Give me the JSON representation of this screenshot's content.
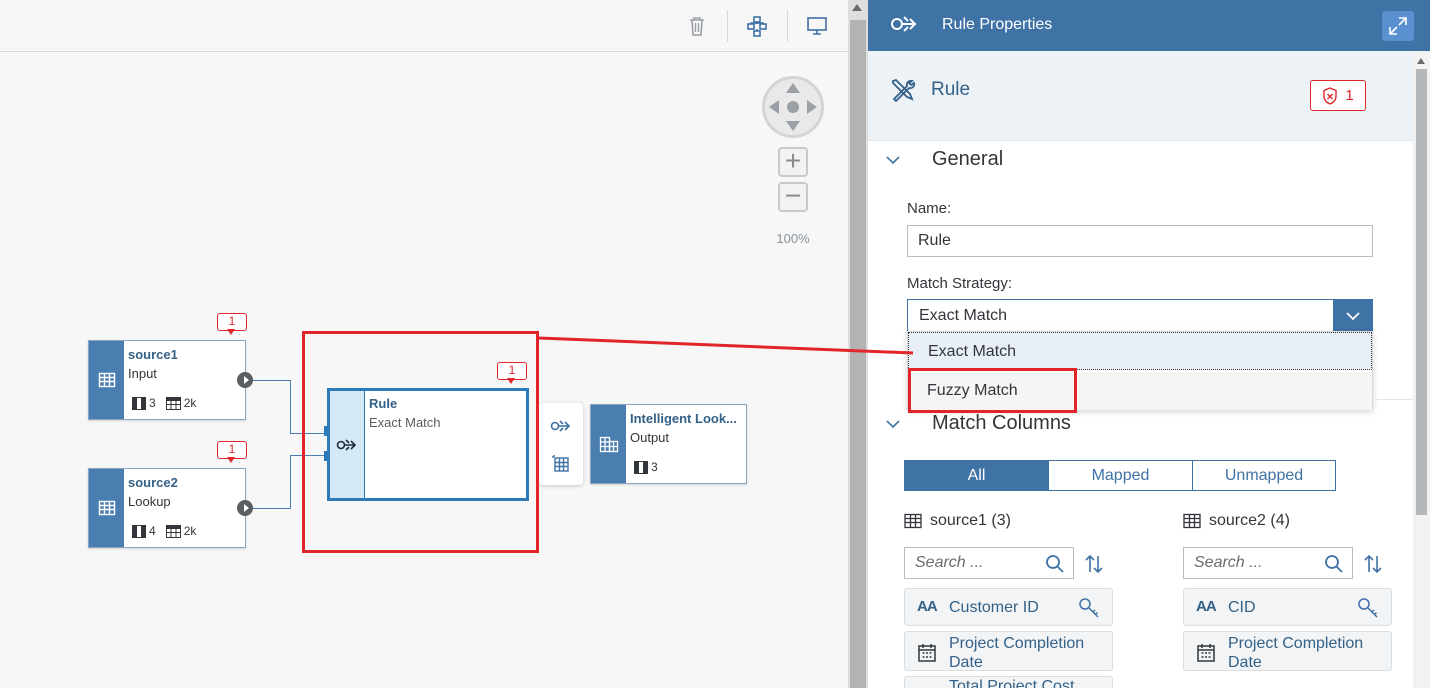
{
  "canvas": {
    "toolbar": {
      "delete_icon": "trash-icon",
      "layout_icon": "auto-layout-icon",
      "preview_icon": "monitor-icon"
    },
    "zoom": {
      "plus": "+",
      "minus": "−",
      "level": "100%"
    },
    "nodes": {
      "source1": {
        "title": "source1",
        "subtitle": "Input",
        "columns": "3",
        "rows": "2k",
        "badge": "1"
      },
      "source2": {
        "title": "source2",
        "subtitle": "Lookup",
        "columns": "4",
        "rows": "2k",
        "badge": "1"
      },
      "rule": {
        "title": "Rule",
        "subtitle": "Exact Match",
        "badge": "1"
      },
      "output": {
        "title": "Intelligent Look...",
        "subtitle": "Output",
        "columns": "3"
      }
    }
  },
  "panel": {
    "header_title": "Rule Properties",
    "rule_title": "Rule",
    "error_count": "1",
    "general": {
      "section_label": "General",
      "name_label": "Name:",
      "name_value": "Rule",
      "strategy_label": "Match Strategy:",
      "strategy_value": "Exact Match",
      "options": [
        "Exact Match",
        "Fuzzy Match"
      ]
    },
    "match_columns": {
      "section_label": "Match Columns",
      "tabs": [
        "All",
        "Mapped",
        "Unmapped"
      ],
      "active_tab": "All",
      "source1": {
        "label": "source1 (3)",
        "search_placeholder": "Search ...",
        "columns": [
          "Customer ID",
          "Project Completion Date",
          "Total Project Cost"
        ]
      },
      "source2": {
        "label": "source2 (4)",
        "search_placeholder": "Search ...",
        "columns": [
          "CID",
          "Project Completion Date"
        ]
      }
    }
  },
  "colors": {
    "accent": "#3f72a5",
    "highlight": "#e0262b",
    "node_side": "#4a7eb0"
  }
}
